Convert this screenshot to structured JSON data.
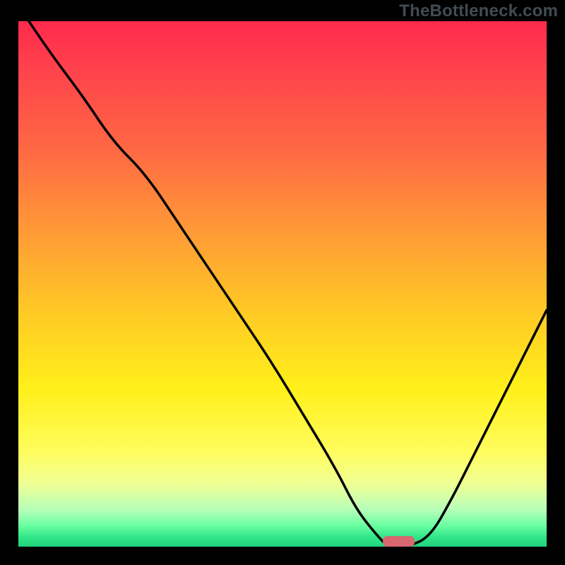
{
  "watermark": "TheBottleneck.com",
  "chart_data": {
    "type": "line",
    "title": "",
    "xlabel": "",
    "ylabel": "",
    "xlim": [
      0,
      100
    ],
    "ylim": [
      0,
      100
    ],
    "x": [
      0,
      6,
      12,
      18,
      24,
      30,
      36,
      42,
      48,
      54,
      60,
      64,
      68,
      70,
      74,
      78,
      82,
      86,
      90,
      94,
      98,
      100
    ],
    "values": [
      103,
      94,
      86,
      77,
      71,
      62,
      53,
      44,
      35,
      25,
      15,
      7,
      2,
      0,
      0,
      2,
      9,
      17,
      25,
      33,
      41,
      45
    ],
    "marker": {
      "x": 72,
      "y": 0,
      "width": 6,
      "height": 2,
      "color": "#d9676f"
    }
  }
}
